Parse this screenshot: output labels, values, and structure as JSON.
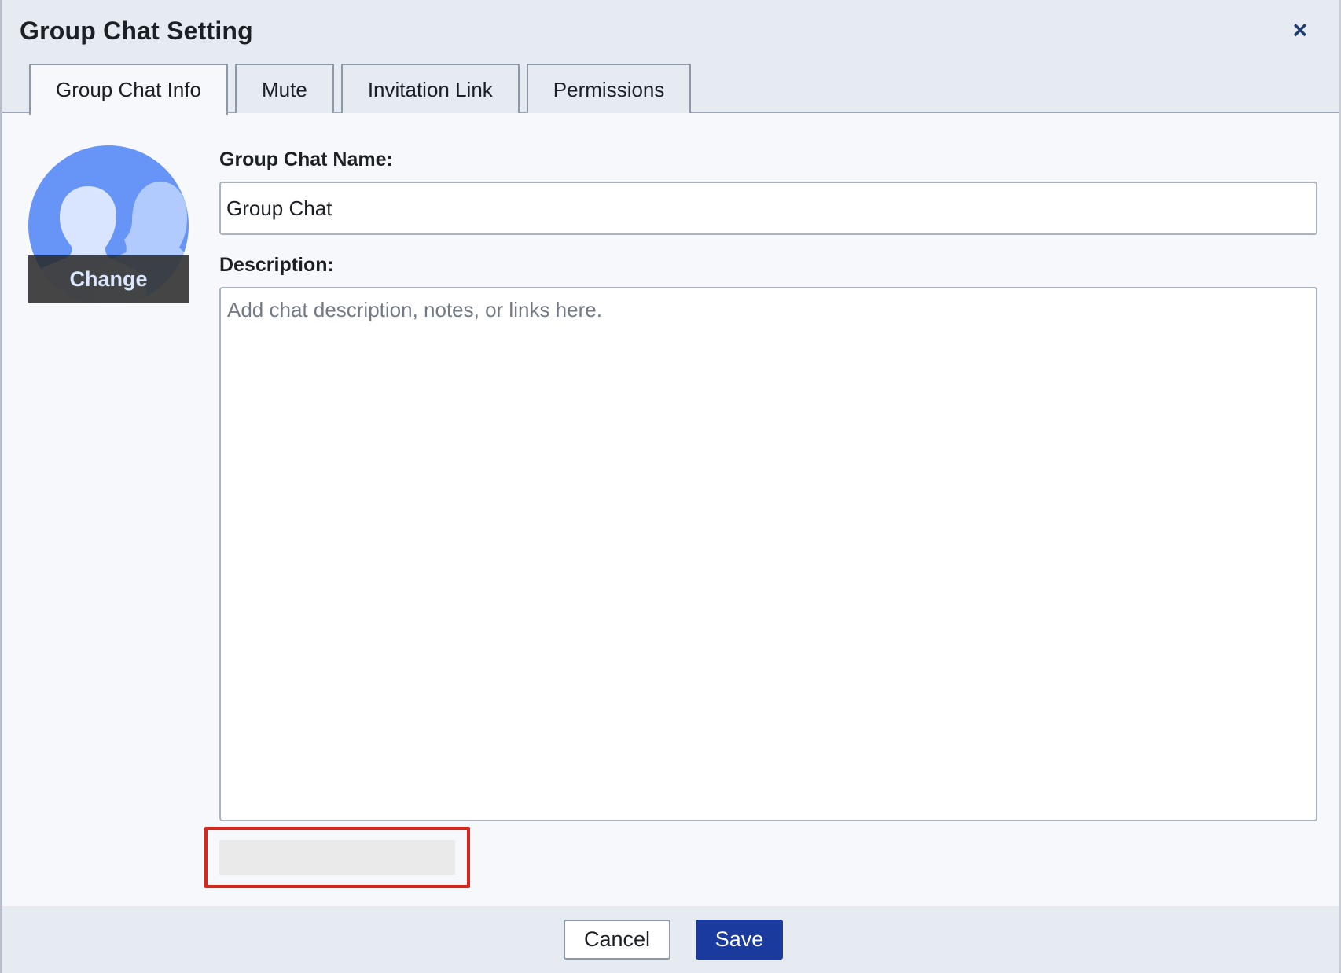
{
  "dialog": {
    "title": "Group Chat Setting",
    "close_symbol": "×"
  },
  "tabs": [
    {
      "label": "Group Chat Info",
      "active": true
    },
    {
      "label": "Mute",
      "active": false
    },
    {
      "label": "Invitation Link",
      "active": false
    },
    {
      "label": "Permissions",
      "active": false
    }
  ],
  "avatar": {
    "icon": "group-avatar-icon",
    "change_label": "Change"
  },
  "form": {
    "name_label": "Group Chat Name:",
    "name_value": "Group Chat",
    "description_label": "Description:",
    "description_value": "",
    "description_placeholder": "Add chat description, notes, or links here."
  },
  "footer": {
    "cancel_label": "Cancel",
    "save_label": "Save"
  },
  "colors": {
    "accent": "#1a3a9e",
    "avatar_bg": "#6795f7",
    "highlight": "#d9261c"
  }
}
